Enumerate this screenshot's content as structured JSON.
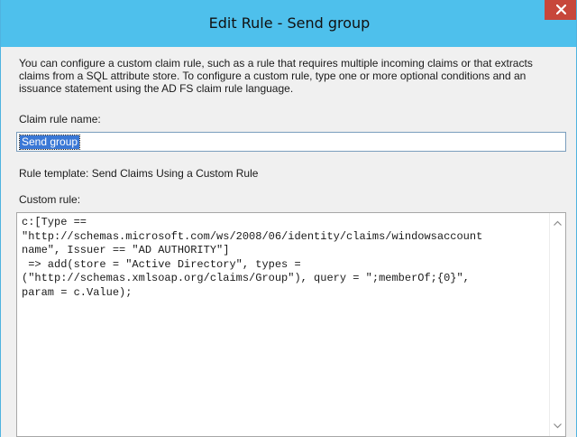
{
  "window": {
    "title": "Edit Rule - Send group",
    "close_icon": "close-icon",
    "colors": {
      "titlebar": "#4ec0ec",
      "close": "#c7473b",
      "selection": "#3a78d6"
    }
  },
  "description": "You can configure a custom claim rule, such as a rule that requires multiple incoming claims or that extracts claims from a SQL attribute store. To configure a custom rule, type one or more optional conditions and an issuance statement using the AD FS claim rule language.",
  "claim_rule_name": {
    "label": "Claim rule name:",
    "value": "Send group"
  },
  "rule_template": "Rule template: Send Claims Using a Custom Rule",
  "custom_rule": {
    "label": "Custom rule:",
    "lines": [
      "c:[Type ==",
      "\"http://schemas.microsoft.com/ws/2008/06/identity/claims/windowsaccount",
      "name\", Issuer == \"AD AUTHORITY\"]",
      " => add(store = \"Active Directory\", types =",
      "(\"http://schemas.xmlsoap.org/claims/Group\"), query = \";memberOf;{0}\",",
      "param = c.Value);"
    ],
    "scroll_up_icon": "chevron-up-icon",
    "scroll_down_icon": "chevron-down-icon"
  }
}
